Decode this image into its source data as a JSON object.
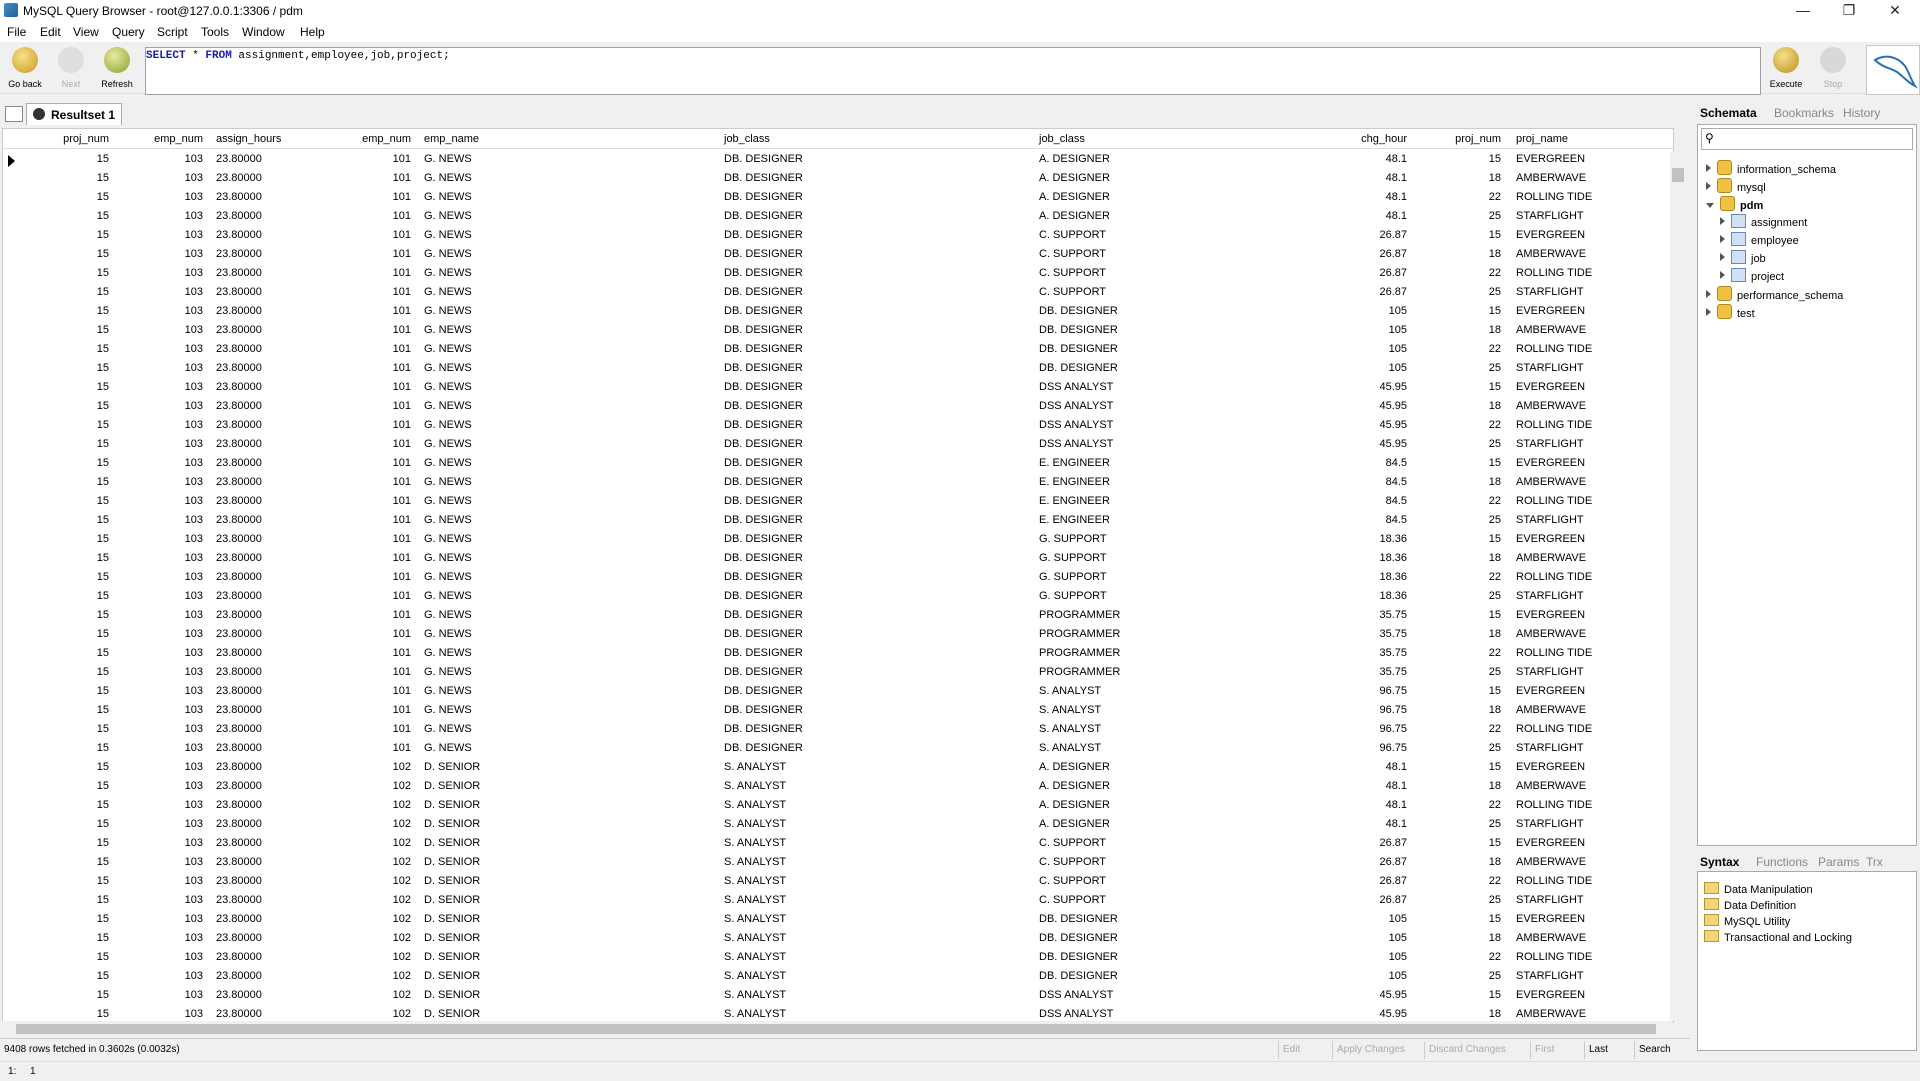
{
  "window": {
    "title": "MySQL Query Browser - root@127.0.0.1:3306 / pdm",
    "min": "—",
    "max": "❐",
    "close": "✕"
  },
  "menu": [
    "File",
    "Edit",
    "View",
    "Query",
    "Script",
    "Tools",
    "Window",
    "Help"
  ],
  "toolbar": {
    "back": "Go back",
    "next": "Next",
    "refresh": "Refresh",
    "execute": "Execute",
    "stop": "Stop"
  },
  "query": {
    "kw1": "SELECT",
    "star": " * ",
    "kw2": "FROM",
    "rest": " assignment,employee,job,project;"
  },
  "result_tab": "Resultset 1",
  "columns": [
    "proj_num",
    "emp_num",
    "assign_hours",
    "emp_num",
    "emp_name",
    "job_class",
    "job_class",
    "chg_hour",
    "proj_num",
    "proj_name"
  ],
  "rows": [
    [
      "15",
      "103",
      "23.80000",
      "101",
      "G. NEWS",
      "DB. DESIGNER",
      "A. DESIGNER",
      "48.1",
      "15",
      "EVERGREEN"
    ],
    [
      "15",
      "103",
      "23.80000",
      "101",
      "G. NEWS",
      "DB. DESIGNER",
      "A. DESIGNER",
      "48.1",
      "18",
      "AMBERWAVE"
    ],
    [
      "15",
      "103",
      "23.80000",
      "101",
      "G. NEWS",
      "DB. DESIGNER",
      "A. DESIGNER",
      "48.1",
      "22",
      "ROLLING TIDE"
    ],
    [
      "15",
      "103",
      "23.80000",
      "101",
      "G. NEWS",
      "DB. DESIGNER",
      "A. DESIGNER",
      "48.1",
      "25",
      "STARFLIGHT"
    ],
    [
      "15",
      "103",
      "23.80000",
      "101",
      "G. NEWS",
      "DB. DESIGNER",
      "C. SUPPORT",
      "26.87",
      "15",
      "EVERGREEN"
    ],
    [
      "15",
      "103",
      "23.80000",
      "101",
      "G. NEWS",
      "DB. DESIGNER",
      "C. SUPPORT",
      "26.87",
      "18",
      "AMBERWAVE"
    ],
    [
      "15",
      "103",
      "23.80000",
      "101",
      "G. NEWS",
      "DB. DESIGNER",
      "C. SUPPORT",
      "26.87",
      "22",
      "ROLLING TIDE"
    ],
    [
      "15",
      "103",
      "23.80000",
      "101",
      "G. NEWS",
      "DB. DESIGNER",
      "C. SUPPORT",
      "26.87",
      "25",
      "STARFLIGHT"
    ],
    [
      "15",
      "103",
      "23.80000",
      "101",
      "G. NEWS",
      "DB. DESIGNER",
      "DB. DESIGNER",
      "105",
      "15",
      "EVERGREEN"
    ],
    [
      "15",
      "103",
      "23.80000",
      "101",
      "G. NEWS",
      "DB. DESIGNER",
      "DB. DESIGNER",
      "105",
      "18",
      "AMBERWAVE"
    ],
    [
      "15",
      "103",
      "23.80000",
      "101",
      "G. NEWS",
      "DB. DESIGNER",
      "DB. DESIGNER",
      "105",
      "22",
      "ROLLING TIDE"
    ],
    [
      "15",
      "103",
      "23.80000",
      "101",
      "G. NEWS",
      "DB. DESIGNER",
      "DB. DESIGNER",
      "105",
      "25",
      "STARFLIGHT"
    ],
    [
      "15",
      "103",
      "23.80000",
      "101",
      "G. NEWS",
      "DB. DESIGNER",
      "DSS ANALYST",
      "45.95",
      "15",
      "EVERGREEN"
    ],
    [
      "15",
      "103",
      "23.80000",
      "101",
      "G. NEWS",
      "DB. DESIGNER",
      "DSS ANALYST",
      "45.95",
      "18",
      "AMBERWAVE"
    ],
    [
      "15",
      "103",
      "23.80000",
      "101",
      "G. NEWS",
      "DB. DESIGNER",
      "DSS ANALYST",
      "45.95",
      "22",
      "ROLLING TIDE"
    ],
    [
      "15",
      "103",
      "23.80000",
      "101",
      "G. NEWS",
      "DB. DESIGNER",
      "DSS ANALYST",
      "45.95",
      "25",
      "STARFLIGHT"
    ],
    [
      "15",
      "103",
      "23.80000",
      "101",
      "G. NEWS",
      "DB. DESIGNER",
      "E. ENGINEER",
      "84.5",
      "15",
      "EVERGREEN"
    ],
    [
      "15",
      "103",
      "23.80000",
      "101",
      "G. NEWS",
      "DB. DESIGNER",
      "E. ENGINEER",
      "84.5",
      "18",
      "AMBERWAVE"
    ],
    [
      "15",
      "103",
      "23.80000",
      "101",
      "G. NEWS",
      "DB. DESIGNER",
      "E. ENGINEER",
      "84.5",
      "22",
      "ROLLING TIDE"
    ],
    [
      "15",
      "103",
      "23.80000",
      "101",
      "G. NEWS",
      "DB. DESIGNER",
      "E. ENGINEER",
      "84.5",
      "25",
      "STARFLIGHT"
    ],
    [
      "15",
      "103",
      "23.80000",
      "101",
      "G. NEWS",
      "DB. DESIGNER",
      "G. SUPPORT",
      "18.36",
      "15",
      "EVERGREEN"
    ],
    [
      "15",
      "103",
      "23.80000",
      "101",
      "G. NEWS",
      "DB. DESIGNER",
      "G. SUPPORT",
      "18.36",
      "18",
      "AMBERWAVE"
    ],
    [
      "15",
      "103",
      "23.80000",
      "101",
      "G. NEWS",
      "DB. DESIGNER",
      "G. SUPPORT",
      "18.36",
      "22",
      "ROLLING TIDE"
    ],
    [
      "15",
      "103",
      "23.80000",
      "101",
      "G. NEWS",
      "DB. DESIGNER",
      "G. SUPPORT",
      "18.36",
      "25",
      "STARFLIGHT"
    ],
    [
      "15",
      "103",
      "23.80000",
      "101",
      "G. NEWS",
      "DB. DESIGNER",
      "PROGRAMMER",
      "35.75",
      "15",
      "EVERGREEN"
    ],
    [
      "15",
      "103",
      "23.80000",
      "101",
      "G. NEWS",
      "DB. DESIGNER",
      "PROGRAMMER",
      "35.75",
      "18",
      "AMBERWAVE"
    ],
    [
      "15",
      "103",
      "23.80000",
      "101",
      "G. NEWS",
      "DB. DESIGNER",
      "PROGRAMMER",
      "35.75",
      "22",
      "ROLLING TIDE"
    ],
    [
      "15",
      "103",
      "23.80000",
      "101",
      "G. NEWS",
      "DB. DESIGNER",
      "PROGRAMMER",
      "35.75",
      "25",
      "STARFLIGHT"
    ],
    [
      "15",
      "103",
      "23.80000",
      "101",
      "G. NEWS",
      "DB. DESIGNER",
      "S. ANALYST",
      "96.75",
      "15",
      "EVERGREEN"
    ],
    [
      "15",
      "103",
      "23.80000",
      "101",
      "G. NEWS",
      "DB. DESIGNER",
      "S. ANALYST",
      "96.75",
      "18",
      "AMBERWAVE"
    ],
    [
      "15",
      "103",
      "23.80000",
      "101",
      "G. NEWS",
      "DB. DESIGNER",
      "S. ANALYST",
      "96.75",
      "22",
      "ROLLING TIDE"
    ],
    [
      "15",
      "103",
      "23.80000",
      "101",
      "G. NEWS",
      "DB. DESIGNER",
      "S. ANALYST",
      "96.75",
      "25",
      "STARFLIGHT"
    ],
    [
      "15",
      "103",
      "23.80000",
      "102",
      "D. SENIOR",
      "S. ANALYST",
      "A. DESIGNER",
      "48.1",
      "15",
      "EVERGREEN"
    ],
    [
      "15",
      "103",
      "23.80000",
      "102",
      "D. SENIOR",
      "S. ANALYST",
      "A. DESIGNER",
      "48.1",
      "18",
      "AMBERWAVE"
    ],
    [
      "15",
      "103",
      "23.80000",
      "102",
      "D. SENIOR",
      "S. ANALYST",
      "A. DESIGNER",
      "48.1",
      "22",
      "ROLLING TIDE"
    ],
    [
      "15",
      "103",
      "23.80000",
      "102",
      "D. SENIOR",
      "S. ANALYST",
      "A. DESIGNER",
      "48.1",
      "25",
      "STARFLIGHT"
    ],
    [
      "15",
      "103",
      "23.80000",
      "102",
      "D. SENIOR",
      "S. ANALYST",
      "C. SUPPORT",
      "26.87",
      "15",
      "EVERGREEN"
    ],
    [
      "15",
      "103",
      "23.80000",
      "102",
      "D. SENIOR",
      "S. ANALYST",
      "C. SUPPORT",
      "26.87",
      "18",
      "AMBERWAVE"
    ],
    [
      "15",
      "103",
      "23.80000",
      "102",
      "D. SENIOR",
      "S. ANALYST",
      "C. SUPPORT",
      "26.87",
      "22",
      "ROLLING TIDE"
    ],
    [
      "15",
      "103",
      "23.80000",
      "102",
      "D. SENIOR",
      "S. ANALYST",
      "C. SUPPORT",
      "26.87",
      "25",
      "STARFLIGHT"
    ],
    [
      "15",
      "103",
      "23.80000",
      "102",
      "D. SENIOR",
      "S. ANALYST",
      "DB. DESIGNER",
      "105",
      "15",
      "EVERGREEN"
    ],
    [
      "15",
      "103",
      "23.80000",
      "102",
      "D. SENIOR",
      "S. ANALYST",
      "DB. DESIGNER",
      "105",
      "18",
      "AMBERWAVE"
    ],
    [
      "15",
      "103",
      "23.80000",
      "102",
      "D. SENIOR",
      "S. ANALYST",
      "DB. DESIGNER",
      "105",
      "22",
      "ROLLING TIDE"
    ],
    [
      "15",
      "103",
      "23.80000",
      "102",
      "D. SENIOR",
      "S. ANALYST",
      "DB. DESIGNER",
      "105",
      "25",
      "STARFLIGHT"
    ],
    [
      "15",
      "103",
      "23.80000",
      "102",
      "D. SENIOR",
      "S. ANALYST",
      "DSS ANALYST",
      "45.95",
      "15",
      "EVERGREEN"
    ],
    [
      "15",
      "103",
      "23.80000",
      "102",
      "D. SENIOR",
      "S. ANALYST",
      "DSS ANALYST",
      "45.95",
      "18",
      "AMBERWAVE"
    ]
  ],
  "status": {
    "fetched": "9408 rows fetched in 0.3602s (0.0032s)",
    "edit": "Edit",
    "apply": "Apply Changes",
    "discard": "Discard Changes",
    "first": "First",
    "last": "Last",
    "search": "Search"
  },
  "position": {
    "line": "1:",
    "col": "1"
  },
  "right_tabs": {
    "schemata": "Schemata",
    "bookmarks": "Bookmarks",
    "history": "History"
  },
  "schemata": [
    "information_schema",
    "mysql",
    "pdm",
    "assignment",
    "employee",
    "job",
    "project",
    "performance_schema",
    "test"
  ],
  "syntax_tabs": {
    "syntax": "Syntax",
    "functions": "Functions",
    "params": "Params",
    "trx": "Trx"
  },
  "syntax_items": [
    "Data Manipulation",
    "Data Definition",
    "MySQL Utility",
    "Transactional and Locking"
  ]
}
